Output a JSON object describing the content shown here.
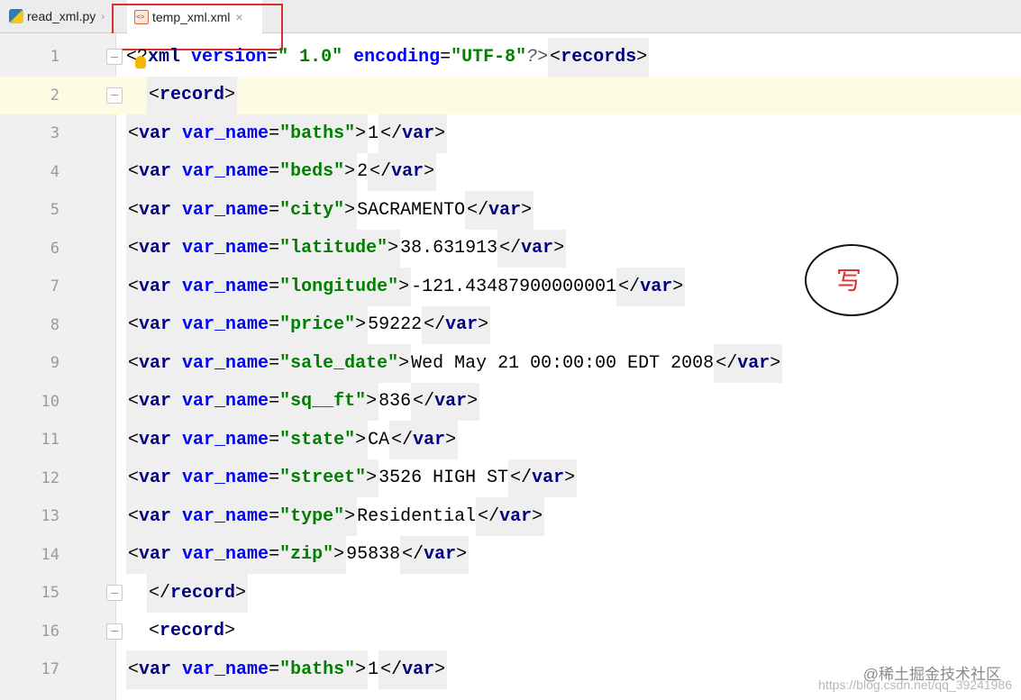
{
  "tabs": [
    {
      "label": "read_xml.py",
      "icon": "python-file-icon"
    },
    {
      "label": "temp_xml.xml",
      "icon": "xml-file-icon",
      "active": true
    }
  ],
  "editor": {
    "line_numbers": [
      "1",
      "2",
      "3",
      "4",
      "5",
      "6",
      "7",
      "8",
      "9",
      "10",
      "11",
      "12",
      "13",
      "14",
      "15",
      "16",
      "17"
    ],
    "decl": {
      "open": "<?",
      "xml_kw": "xml",
      "version_attr": "version",
      "version_val": "\" 1.0\"",
      "encoding_attr": "encoding",
      "encoding_val": "\"UTF-8\"",
      "close": "?>",
      "root_tag": "records"
    },
    "record_open": "record",
    "record_close": "record",
    "vars": [
      {
        "name": "\"baths\"",
        "value": "1"
      },
      {
        "name": "\"beds\"",
        "value": "2"
      },
      {
        "name": "\"city\"",
        "value": "SACRAMENTO"
      },
      {
        "name": "\"latitude\"",
        "value": "38.631913"
      },
      {
        "name": "\"longitude\"",
        "value": "-121.43487900000001"
      },
      {
        "name": "\"price\"",
        "value": "59222"
      },
      {
        "name": "\"sale_date\"",
        "value": "Wed May 21 00:00:00 EDT 2008"
      },
      {
        "name": "\"sq__ft\"",
        "value": "836"
      },
      {
        "name": "\"state\"",
        "value": "CA"
      },
      {
        "name": "\"street\"",
        "value": "3526 HIGH ST"
      },
      {
        "name": "\"type\"",
        "value": "Residential"
      },
      {
        "name": "\"zip\"",
        "value": "95838"
      }
    ],
    "second_record_first_var": {
      "name": "\"baths\"",
      "value": "1"
    },
    "var_tag": "var",
    "var_attr": "var_name"
  },
  "annotation": {
    "text": "写"
  },
  "watermark": {
    "line1": "@稀土掘金技术社区",
    "line2": "https://blog.csdn.net/qq_39241986"
  },
  "colors": {
    "tag": "#000080",
    "attr": "#0000ff",
    "string": "#008000",
    "selection": "#a6d2ff",
    "current_line": "#fdfbe3",
    "red_box": "#d9312f"
  }
}
